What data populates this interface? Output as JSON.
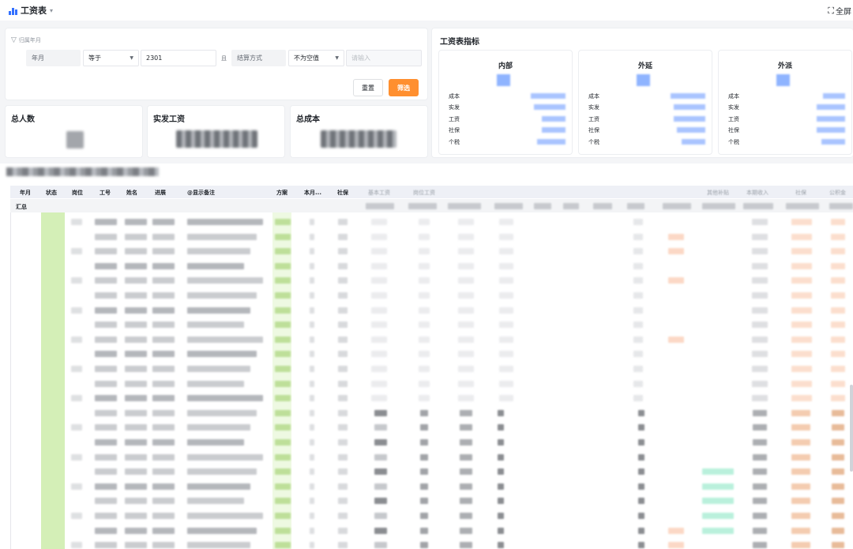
{
  "app": {
    "title": "工资表",
    "fullscreen_label": "全屏"
  },
  "filter": {
    "title": "归属年月",
    "field1": "年月",
    "operator1": "等于",
    "value1": "2301",
    "conjunction": "且",
    "field2": "结算方式",
    "operator2": "不为空值",
    "value2_placeholder": "请输入",
    "reset_label": "重置",
    "apply_label": "筛选"
  },
  "metrics": [
    {
      "title": "总人数"
    },
    {
      "title": "实发工资"
    },
    {
      "title": "总成本"
    }
  ],
  "indicators": {
    "title": "工资表指标",
    "groups": [
      {
        "name": "内部",
        "rows": [
          "成本",
          "实发",
          "工资",
          "社保",
          "个税"
        ]
      },
      {
        "name": "外延",
        "rows": [
          "成本",
          "实发",
          "工资",
          "社保",
          "个税"
        ]
      },
      {
        "name": "外派",
        "rows": [
          "成本",
          "实发",
          "工资",
          "社保",
          "个税"
        ]
      }
    ]
  },
  "table": {
    "columns": [
      "年月",
      "状态",
      "岗位",
      "工号",
      "姓名",
      "进展",
      "@显示备注",
      "方案",
      "本月...",
      "社保"
    ],
    "faded_columns": [
      "基本工资",
      "岗位工资",
      "其他补贴",
      "本期收入",
      "社保",
      "公积金"
    ],
    "summary_label": "汇总"
  }
}
